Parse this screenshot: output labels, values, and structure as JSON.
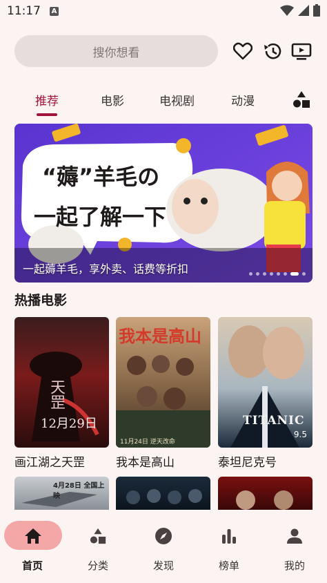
{
  "status_bar": {
    "time": "11:17",
    "notification_icon": "A"
  },
  "search": {
    "placeholder": "搜你想看"
  },
  "header_icons": [
    "heart-icon",
    "history-icon",
    "tv-icon"
  ],
  "tabs": [
    {
      "label": "推荐",
      "active": true
    },
    {
      "label": "电影",
      "active": false
    },
    {
      "label": "电视剧",
      "active": false
    },
    {
      "label": "动漫",
      "active": false
    }
  ],
  "banner": {
    "headline_1": "“薅”羊毛の",
    "headline_2": "一起了解一下",
    "caption": "一起薅羊毛，享外卖、话费等折扣",
    "dots": 8,
    "active_dot": 7
  },
  "hot_movies": {
    "title": "热播电影",
    "items": [
      {
        "title": "画江湖之天罡",
        "poster_text": "12月29日",
        "poster_sub": "天罡"
      },
      {
        "title": "我本是高山",
        "poster_text": "我本是高山",
        "poster_sub": "11月24日 逆天改命"
      },
      {
        "title": "泰坦尼克号",
        "poster_text": "TITANIC",
        "poster_sub": "9.5"
      }
    ],
    "next_row_banner": "4月28日 全国上映"
  },
  "bottom_nav": [
    {
      "label": "首页",
      "icon": "home-icon",
      "active": true
    },
    {
      "label": "分类",
      "icon": "category-icon",
      "active": false
    },
    {
      "label": "发现",
      "icon": "compass-icon",
      "active": false
    },
    {
      "label": "榜单",
      "icon": "chart-icon",
      "active": false
    },
    {
      "label": "我的",
      "icon": "person-icon",
      "active": false
    }
  ],
  "colors": {
    "accent": "#a3123a",
    "nav_active_bg": "#f4a7a7",
    "background": "#fcf4f2"
  }
}
